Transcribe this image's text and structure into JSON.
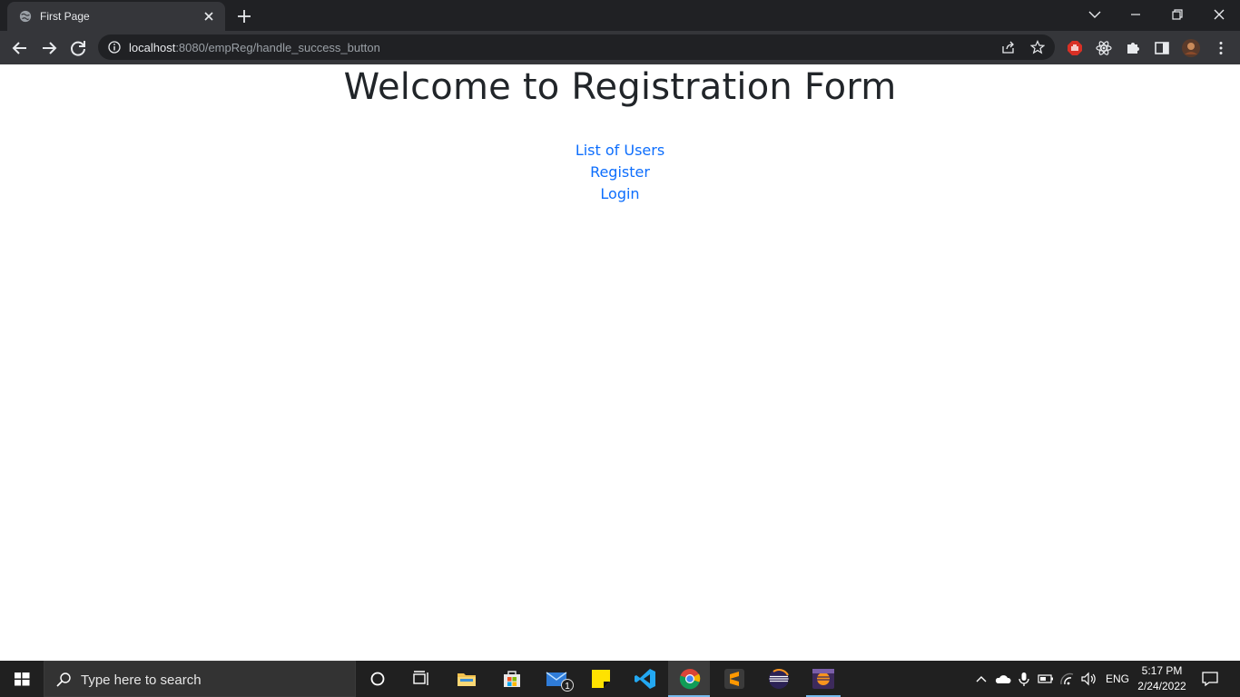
{
  "browser": {
    "tab_title": "First Page",
    "url_host": "localhost",
    "url_rest": ":8080/empReg/handle_success_button"
  },
  "page": {
    "heading": "Welcome to Registration Form",
    "links": [
      "List of Users",
      "Register",
      "Login"
    ]
  },
  "taskbar": {
    "search_placeholder": "Type here to search",
    "language": "ENG",
    "time": "5:17 PM",
    "date": "2/24/2022",
    "mail_badge": "1"
  },
  "icons": {
    "toolbar": [
      "back-icon",
      "forward-icon",
      "reload-icon",
      "info-icon",
      "share-icon",
      "star-icon"
    ],
    "extensions": [
      "adblock-icon",
      "react-devtools-icon",
      "extensions-icon",
      "side-panel-icon",
      "profile-avatar",
      "menu-icon"
    ],
    "taskbar_apps": [
      "cortana-icon",
      "task-view-icon",
      "file-explorer-icon",
      "microsoft-store-icon",
      "mail-icon",
      "sticky-notes-icon",
      "vscode-icon",
      "chrome-icon",
      "sublime-text-icon",
      "eclipse-icon",
      "eclipse-jee-icon"
    ]
  },
  "colors": {
    "link": "#0d6efd",
    "heading": "#212529",
    "chrome_dark": "#202124",
    "taskbar": "#202020"
  }
}
